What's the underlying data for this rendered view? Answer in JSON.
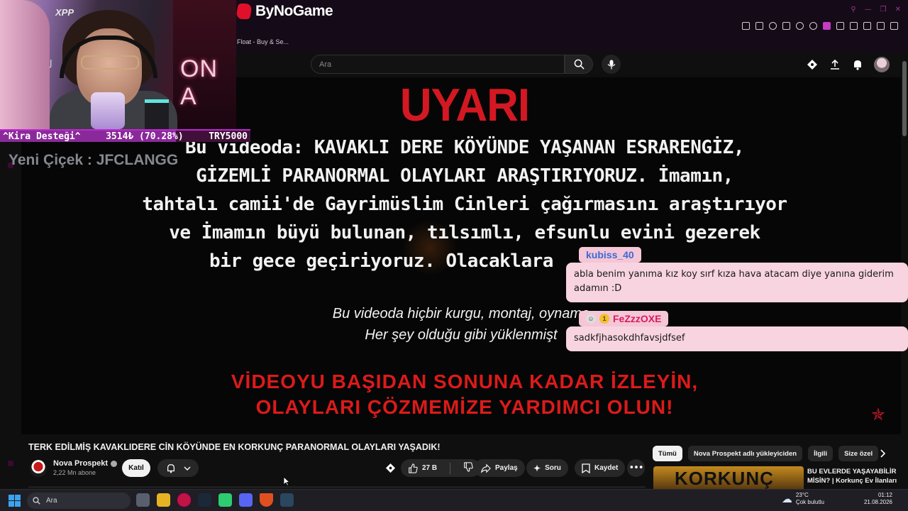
{
  "browser": {
    "brand": "ByNoGame",
    "tab_title": "Float - Buy & Se..."
  },
  "youtube_header": {
    "search_placeholder": "Ara"
  },
  "video_frame": {
    "heading": "UYARI",
    "warning_lines": [
      "Bu videoda: KAVAKLI DERE KÖYÜNDE YAŞANAN ESRARENGİZ,",
      "GİZEMLİ PARANORMAL OLAYLARI ARAŞTIRIYORUZ. İmamın,",
      "tahtalı camii'de Gayrimüslim Cinleri çağırmasını araştırıyor",
      "ve İmamın büyü bulunan, tılsımlı, efsunlu evini gezerek",
      "bir gece geçiriyoruz. Olacaklara"
    ],
    "italic_lines": [
      "Bu videoda hiçbir kurgu, montaj, oynama",
      "Her şey olduğu gibi yüklenmişt"
    ],
    "red_lines": [
      "VİDEOYU BAŞIDAN SONUNA KADAR İZLEYİN,",
      "OLAYLARI ÇÖZMEMİZE YARDIMCI OLUN!"
    ]
  },
  "stream_overlay": {
    "webcam_brand": "XPP",
    "neon_text": "ON A",
    "donation_label": "^Kira Desteği^",
    "donation_amount": "3514₺ (70.28%)",
    "donation_goal": "TRY5000",
    "donation_progress": 0.7028,
    "new_follower_text": "Yeni Çiçek : JFCLANGG"
  },
  "chat": [
    {
      "username": "kubiss_40",
      "message": "abla benim yanıma kız koy sırf kıza hava atacam diye yanına giderim adamın :D",
      "name_color": "#3a6ad6"
    },
    {
      "username": "FeZzzOXE",
      "message": "sadkfjhasokdhfavsjdfsef",
      "name_color": "#d81b60"
    }
  ],
  "video_info": {
    "title": "TERK EDİLMİŞ KAVAKLIDERE CİN KÖYÜNDE EN KORKUNÇ PARANORMAL OLAYLARI YAŞADIK!",
    "channel_name": "Nova Prospekt",
    "subscribers": "2,22 Mn abone",
    "join_label": "Katıl",
    "likes": "27 B",
    "share_label": "Paylaş",
    "ask_label": "Soru",
    "save_label": "Kaydet"
  },
  "sidebar": {
    "chips": [
      "Tümü",
      "Nova Prospekt adlı yükleyiciden",
      "İlgili",
      "Size özel"
    ],
    "recommendation": {
      "thumb_text": "KORKUNÇ",
      "title": "BU EVLERDE YAŞAYABİLİR MİSİN? | Korkunç Ev İlanları"
    }
  },
  "taskbar": {
    "search_placeholder": "Ara",
    "weather_temp": "23°C",
    "weather_desc": "Çok bulutlu",
    "time": "01:12",
    "date": "21.08.2026"
  },
  "colors": {
    "accent_red": "#d31822",
    "chat_bubble": "#f8d4e0",
    "donation_bar": "#8a2a9a"
  }
}
